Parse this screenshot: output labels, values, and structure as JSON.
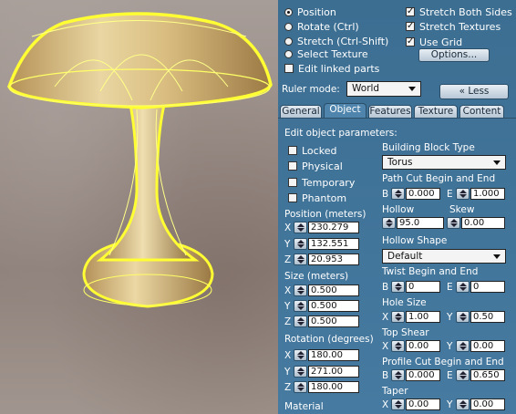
{
  "edit_modes": {
    "options": [
      "Position",
      "Rotate (Ctrl)",
      "Stretch (Ctrl-Shift)",
      "Select Texture"
    ],
    "selected_index": 0
  },
  "stretch_options": {
    "stretch_both_sides": {
      "label": "Stretch Both Sides",
      "checked": true
    },
    "stretch_textures": {
      "label": "Stretch Textures",
      "checked": true
    },
    "use_grid": {
      "label": "Use Grid",
      "checked": true
    }
  },
  "options_button": "Options...",
  "edit_linked_parts": {
    "label": "Edit linked parts",
    "checked": false
  },
  "ruler": {
    "label": "Ruler mode:",
    "value": "World"
  },
  "less_button": "« Less",
  "tabs": [
    "General",
    "Object",
    "Features",
    "Texture",
    "Content"
  ],
  "active_tab": "Object",
  "object": {
    "heading": "Edit object parameters:",
    "flags": [
      {
        "label": "Locked",
        "checked": false
      },
      {
        "label": "Physical",
        "checked": false
      },
      {
        "label": "Temporary",
        "checked": false
      },
      {
        "label": "Phantom",
        "checked": false
      }
    ],
    "position": {
      "label": "Position (meters)",
      "x": "230.279",
      "y": "132.551",
      "z": "20.953"
    },
    "size": {
      "label": "Size (meters)",
      "x": "0.500",
      "y": "0.500",
      "z": "0.500"
    },
    "rotation": {
      "label": "Rotation (degrees)",
      "x": "180.00",
      "y": "271.00",
      "z": "180.00"
    },
    "material_label": "Material",
    "building_block": {
      "label": "Building Block Type",
      "value": "Torus"
    },
    "path_cut": {
      "label": "Path Cut Begin and End",
      "b": "0.000",
      "e": "1.000"
    },
    "hollow": {
      "label": "Hollow",
      "value": "95.0"
    },
    "skew": {
      "label": "Skew",
      "value": "0.00"
    },
    "hollow_shape": {
      "label": "Hollow Shape",
      "value": "Default"
    },
    "twist": {
      "label": "Twist Begin and End",
      "b": "0",
      "e": "0"
    },
    "hole_size": {
      "label": "Hole Size",
      "x": "1.00",
      "y": "0.50"
    },
    "top_shear": {
      "label": "Top Shear",
      "x": "0.00",
      "y": "0.00"
    },
    "profile_cut": {
      "label": "Profile Cut Begin and End",
      "b": "0.000",
      "e": "0.650"
    },
    "taper": {
      "label": "Taper",
      "x": "0.00",
      "y": "0.00"
    },
    "axis_labels": {
      "x": "X",
      "y": "Y",
      "z": "Z",
      "b": "B",
      "e": "E"
    }
  },
  "colors": {
    "panel_bg": "#467aa0",
    "selection_outline": "#ffff33",
    "object_fill": "#d8b870"
  }
}
